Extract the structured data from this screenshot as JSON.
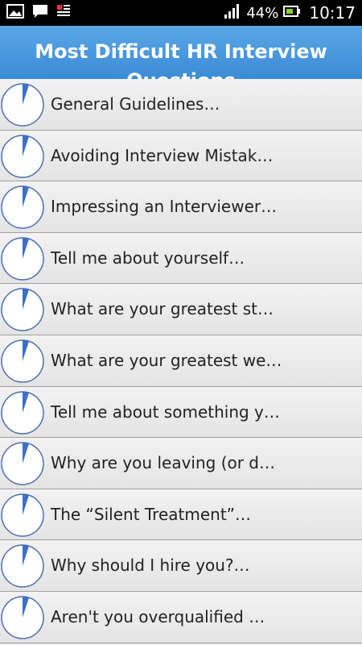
{
  "status_bar": {
    "battery_percent": "44%",
    "time": "10:17",
    "icons": [
      "picture-icon",
      "message-icon",
      "notification-icon",
      "signal-icon",
      "battery-icon"
    ]
  },
  "header": {
    "title": "Most Difficult HR Interview Questions"
  },
  "colors": {
    "header_blue": "#3b8bd6",
    "pie_blue": "#3d6fc8"
  },
  "list": {
    "items": [
      {
        "label": "General Guidelines…"
      },
      {
        "label": "Avoiding Interview Mistak…"
      },
      {
        "label": "Impressing an Interviewer…"
      },
      {
        "label": "Tell me about yourself…"
      },
      {
        "label": "What are your greatest st…"
      },
      {
        "label": "What are your greatest we…"
      },
      {
        "label": "Tell me about something y…"
      },
      {
        "label": "Why are you leaving (or d…"
      },
      {
        "label": "The “Silent Treatment”…"
      },
      {
        "label": "Why should I hire you?…"
      },
      {
        "label": "Aren't you overqualified …"
      }
    ]
  }
}
